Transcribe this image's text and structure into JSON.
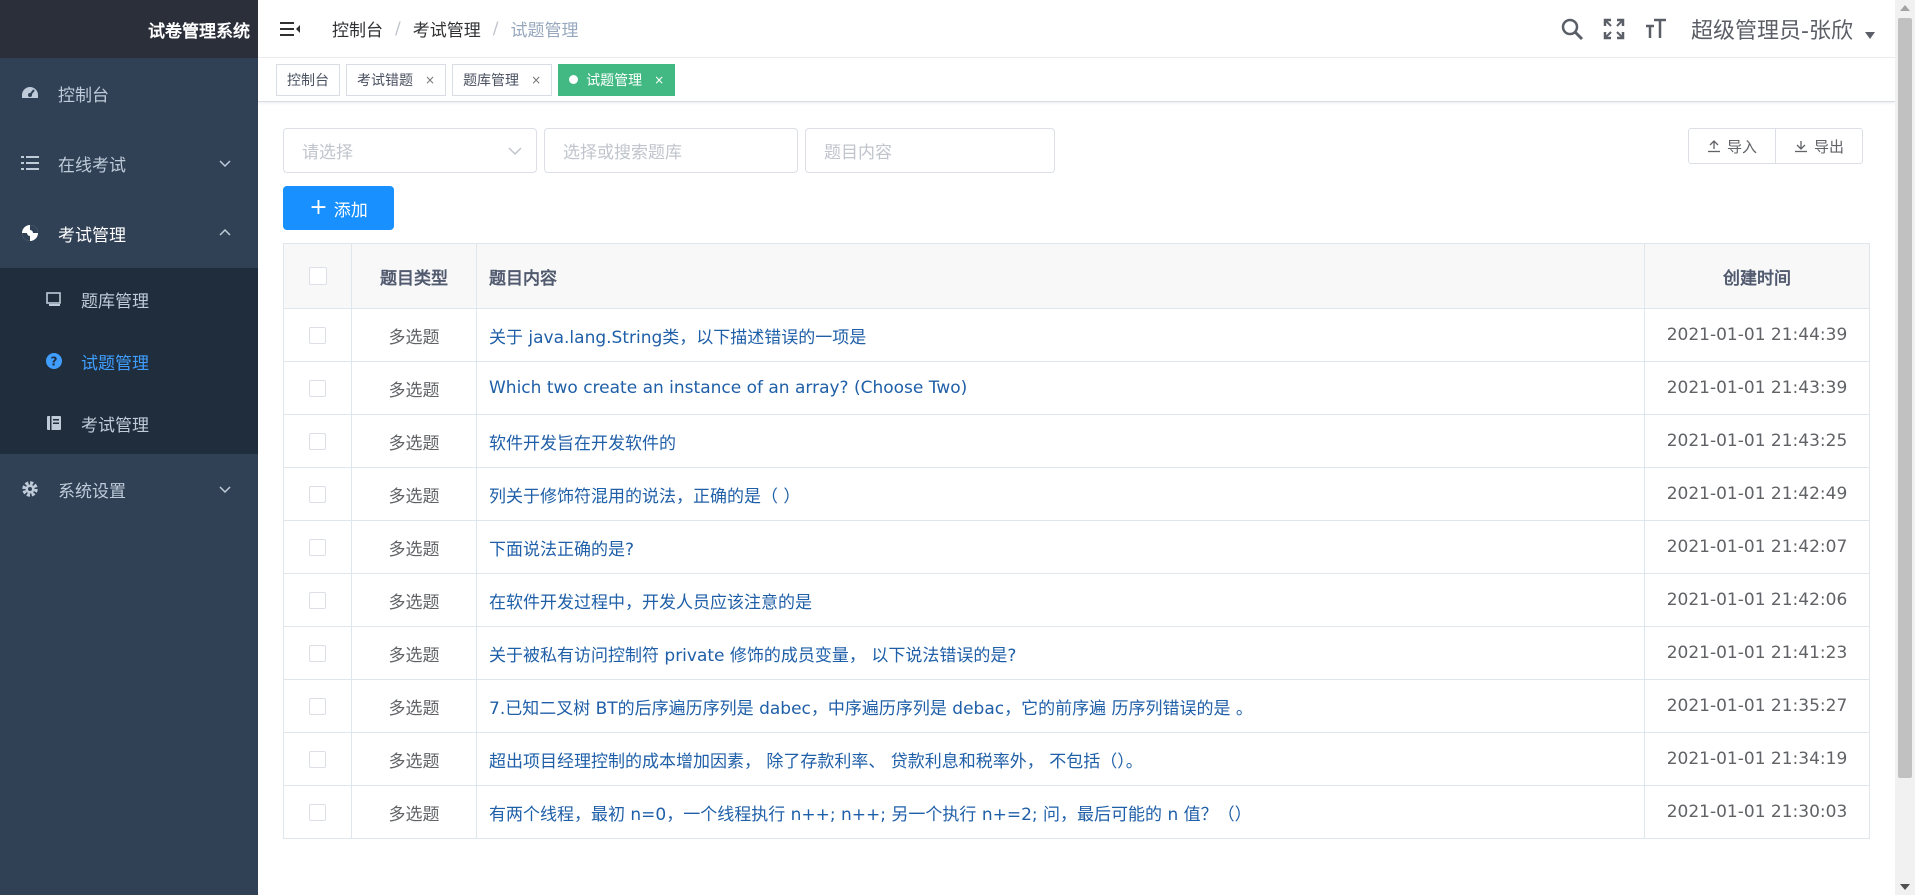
{
  "sidebar": {
    "logo": "试卷管理系统",
    "items": [
      {
        "label": "控制台",
        "icon": "dashboard-icon"
      },
      {
        "label": "在线考试",
        "icon": "list-icon"
      },
      {
        "label": "考试管理",
        "icon": "exam-icon"
      },
      {
        "label": "系统设置",
        "icon": "gear-icon"
      }
    ],
    "sub_items": [
      {
        "label": "题库管理",
        "icon": "bank-icon"
      },
      {
        "label": "试题管理",
        "icon": "question-icon"
      },
      {
        "label": "考试管理",
        "icon": "book-icon"
      }
    ]
  },
  "navbar": {
    "breadcrumb": [
      "控制台",
      "考试管理",
      "试题管理"
    ],
    "user": "超级管理员-张欣"
  },
  "tags": [
    {
      "label": "控制台"
    },
    {
      "label": "考试错题"
    },
    {
      "label": "题库管理"
    },
    {
      "label": "试题管理"
    }
  ],
  "tag_close": "×",
  "filters": {
    "type_placeholder": "请选择",
    "bank_placeholder": "选择或搜索题库",
    "content_placeholder": "题目内容"
  },
  "buttons": {
    "import": "导入",
    "export": "导出",
    "add": "添加"
  },
  "table": {
    "headers": {
      "type": "题目类型",
      "content": "题目内容",
      "time": "创建时间"
    },
    "rows": [
      {
        "type": "多选题",
        "content": "关于 java.lang.String类，以下描述错误的一项是",
        "time": "2021-01-01 21:44:39"
      },
      {
        "type": "多选题",
        "content": "Which two create an instance of an array? (Choose Two)",
        "time": "2021-01-01 21:43:39"
      },
      {
        "type": "多选题",
        "content": "软件开发旨在开发软件的",
        "time": "2021-01-01 21:43:25"
      },
      {
        "type": "多选题",
        "content": "列关于修饰符混用的说法，正确的是（ ）",
        "time": "2021-01-01 21:42:49"
      },
      {
        "type": "多选题",
        "content": "下面说法正确的是?",
        "time": "2021-01-01 21:42:07"
      },
      {
        "type": "多选题",
        "content": "在软件开发过程中，开发人员应该注意的是",
        "time": "2021-01-01 21:42:06"
      },
      {
        "type": "多选题",
        "content": "关于被私有访问控制符 private 修饰的成员变量， 以下说法错误的是?",
        "time": "2021-01-01 21:41:23"
      },
      {
        "type": "多选题",
        "content": "7.已知二叉树 BT的后序遍历序列是 dabec，中序遍历序列是 debac，它的前序遍 历序列错误的是 。",
        "time": "2021-01-01 21:35:27"
      },
      {
        "type": "多选题",
        "content": "超出项目经理控制的成本增加因素， 除了存款利率、 贷款利息和税率外， 不包括（）。",
        "time": "2021-01-01 21:34:19"
      },
      {
        "type": "多选题",
        "content": "有两个线程，最初 n=0，一个线程执行 n++; n++; 另一个执行 n+=2; 问，最后可能的 n 值？（）",
        "time": "2021-01-01 21:30:03"
      }
    ]
  },
  "colors": {
    "sidebar_bg": "#304156",
    "submenu_bg": "#1f2d3d",
    "active_menu": "#409eff",
    "primary_button": "#1890ff",
    "active_tag": "#42b983",
    "link_text": "#1f5fa8"
  }
}
